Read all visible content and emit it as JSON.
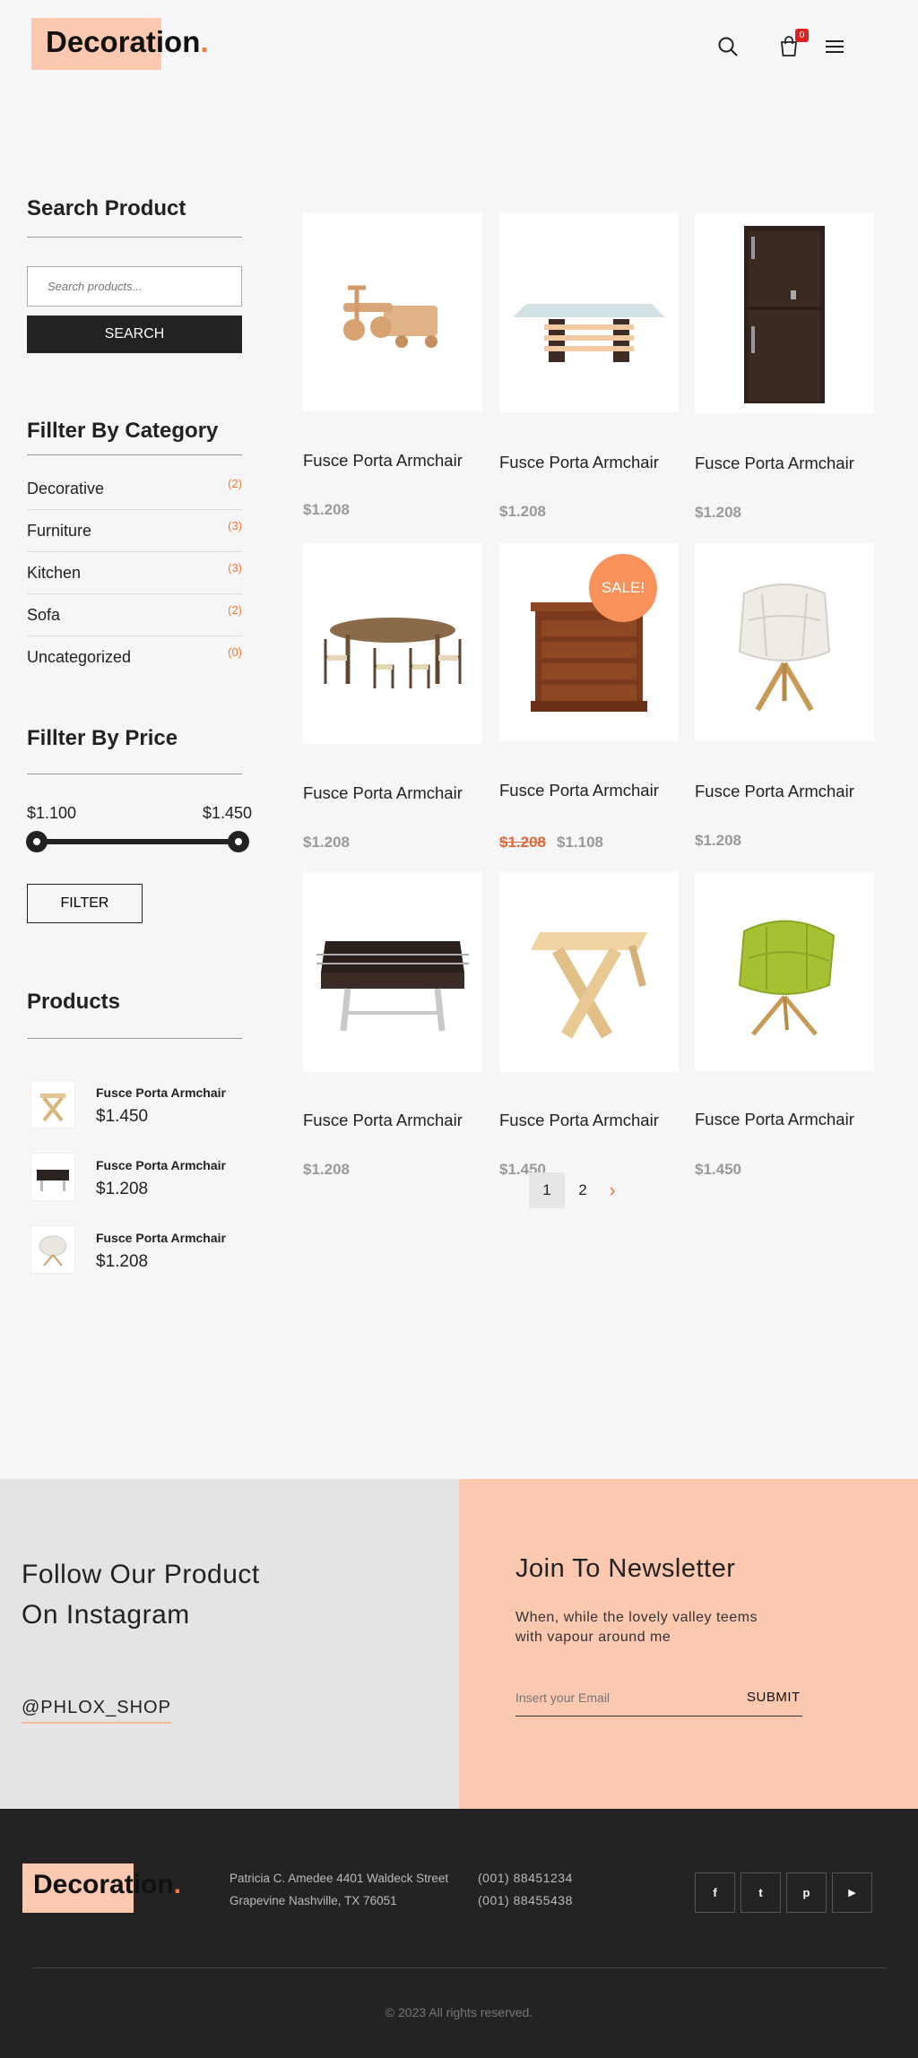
{
  "header": {
    "logo_main": "Decoration",
    "logo_dot": ".",
    "cart_count": "0",
    "icons": [
      "search-icon",
      "cart-icon",
      "menu-icon"
    ]
  },
  "sidebar": {
    "search_title": "Search Product",
    "search_placeholder": "Search products...",
    "search_button": "SEARCH",
    "category_title": "Fillter By Category",
    "categories": [
      {
        "name": "Decorative",
        "count": "(2)"
      },
      {
        "name": "Furniture",
        "count": "(3)"
      },
      {
        "name": "Kitchen",
        "count": "(3)"
      },
      {
        "name": "Sofa",
        "count": "(2)"
      },
      {
        "name": "Uncategorized",
        "count": "(0)"
      }
    ],
    "price_title": "Fillter By Price",
    "price_min": "$1.100",
    "price_max": "$1.450",
    "filter_button": "FILTER",
    "products_title": "Products",
    "products": [
      {
        "name": "Fusce Porta Armchair",
        "price": "$1.450",
        "thumb": "folding-stool"
      },
      {
        "name": "Fusce Porta Armchair",
        "price": "$1.208",
        "thumb": "foosball-table"
      },
      {
        "name": "Fusce Porta Armchair",
        "price": "$1.208",
        "thumb": "lounge-chair"
      }
    ]
  },
  "grid": {
    "products": [
      {
        "name": "Fusce Porta Armchair",
        "price": "$1.208",
        "image": "wooden-toy-tricycle"
      },
      {
        "name": "Fusce Porta Armchair",
        "price": "$1.208",
        "image": "glass-coffee-table"
      },
      {
        "name": "Fusce Porta Armchair",
        "price": "$1.208",
        "image": "dark-wood-wardrobe"
      },
      {
        "name": "Fusce Porta Armchair",
        "price": "$1.208",
        "image": "dining-table-set"
      },
      {
        "name": "Fusce Porta Armchair",
        "old_price": "$1.208",
        "price": "$1.108",
        "image": "wooden-dresser",
        "badge": "SALE!"
      },
      {
        "name": "Fusce Porta Armchair",
        "price": "$1.208",
        "image": "white-lounge-chair"
      },
      {
        "name": "Fusce Porta Armchair",
        "price": "$1.208",
        "image": "foosball-table"
      },
      {
        "name": "Fusce Porta Armchair",
        "price": "$1.450",
        "image": "folding-stool"
      },
      {
        "name": "Fusce Porta Armchair",
        "price": "$1.450",
        "image": "green-lounge-chair"
      }
    ],
    "pagination": {
      "pages": [
        "1",
        "2"
      ],
      "next": "›"
    }
  },
  "instagram": {
    "title_line1": "Follow Our Product",
    "title_line2": "On Instagram",
    "handle": "@PHLOX_SHOP"
  },
  "newsletter": {
    "title": "Join To Newsletter",
    "text_line1": "When, while the lovely valley teems",
    "text_line2": "with vapour around me",
    "placeholder": "Insert your Email",
    "submit": "SUBMIT"
  },
  "footer": {
    "logo_main": "Decoration",
    "logo_dot": ".",
    "address_line1": "Patricia C. Amedee 4401 Waldeck Street",
    "address_line2": "Grapevine Nashville, TX 76051",
    "phone1": "(001) 88451234",
    "phone2": "(001) 88455438",
    "social": [
      {
        "icon": "facebook-icon",
        "glyph": "f"
      },
      {
        "icon": "twitter-icon",
        "glyph": "t"
      },
      {
        "icon": "pinterest-icon",
        "glyph": "p"
      },
      {
        "icon": "youtube-icon",
        "glyph": "▶"
      }
    ],
    "copyright": "© 2023 All rights reserved."
  },
  "colors": {
    "accent": "#f07a3a",
    "peach": "#fcc8b0",
    "dark": "#232323",
    "sale": "#f9925a"
  }
}
